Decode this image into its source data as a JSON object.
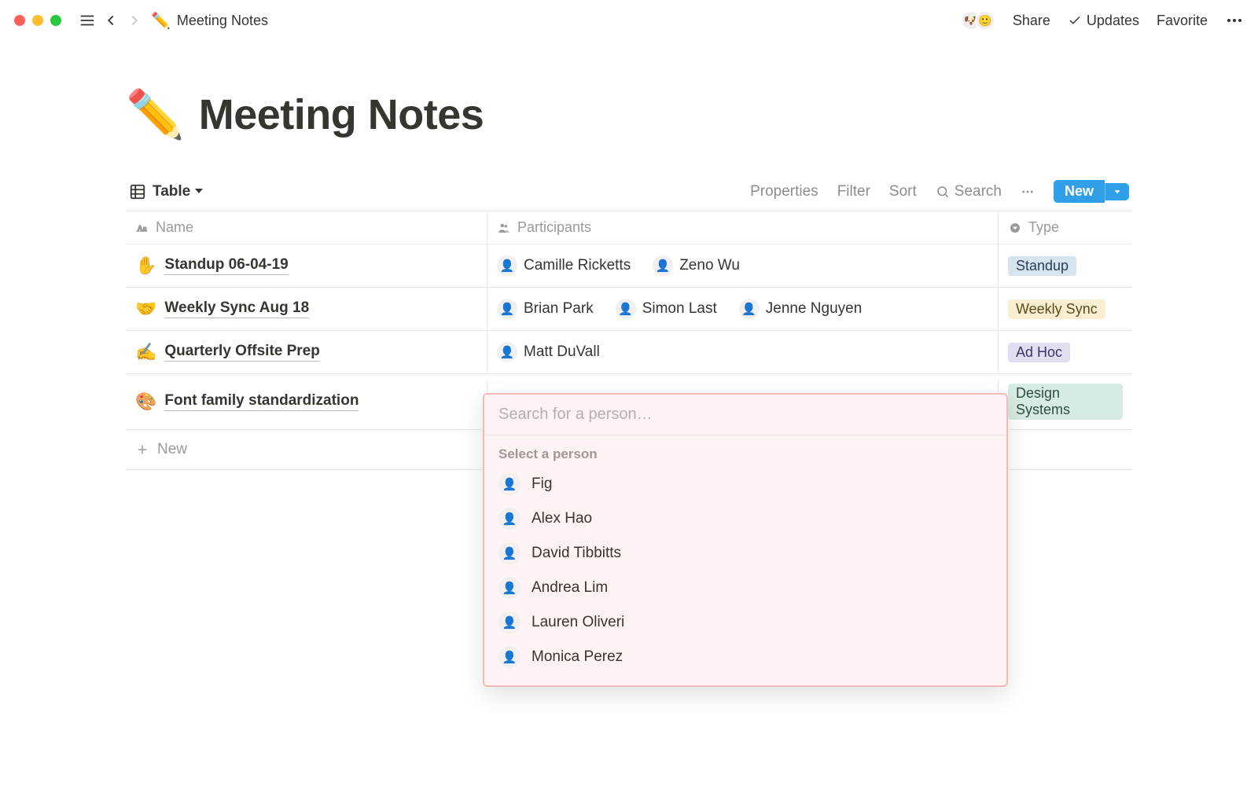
{
  "breadcrumb": {
    "icon": "✏️",
    "title": "Meeting Notes"
  },
  "topbar": {
    "share": "Share",
    "updates": "Updates",
    "favorite": "Favorite"
  },
  "page": {
    "icon": "✏️",
    "title": "Meeting Notes"
  },
  "viewbar": {
    "view_label": "Table",
    "properties": "Properties",
    "filter": "Filter",
    "sort": "Sort",
    "search": "Search",
    "new": "New"
  },
  "columns": {
    "name": "Name",
    "participants": "Participants",
    "type": "Type"
  },
  "rows": [
    {
      "emoji": "✋",
      "title": "Standup 06-04-19",
      "participants": [
        {
          "name": "Camille Ricketts"
        },
        {
          "name": "Zeno Wu"
        }
      ],
      "type_label": "Standup",
      "type_class": "standup"
    },
    {
      "emoji": "🤝",
      "title": "Weekly Sync Aug 18",
      "participants": [
        {
          "name": "Brian Park"
        },
        {
          "name": "Simon Last"
        },
        {
          "name": "Jenne Nguyen"
        }
      ],
      "type_label": "Weekly Sync",
      "type_class": "weekly"
    },
    {
      "emoji": "✍️",
      "title": "Quarterly Offsite Prep",
      "participants": [
        {
          "name": "Matt DuVall"
        }
      ],
      "type_label": "Ad Hoc",
      "type_class": "adhoc"
    },
    {
      "emoji": "🎨",
      "title": "Font family standardization",
      "participants": [],
      "type_label": "Design Systems",
      "type_class": "design"
    }
  ],
  "addrow_label": "New",
  "popover": {
    "placeholder": "Search for a person…",
    "section": "Select a person",
    "options": [
      {
        "name": "Fig"
      },
      {
        "name": "Alex Hao"
      },
      {
        "name": "David Tibbitts"
      },
      {
        "name": "Andrea Lim"
      },
      {
        "name": "Lauren Oliveri"
      },
      {
        "name": "Monica Perez"
      }
    ]
  }
}
